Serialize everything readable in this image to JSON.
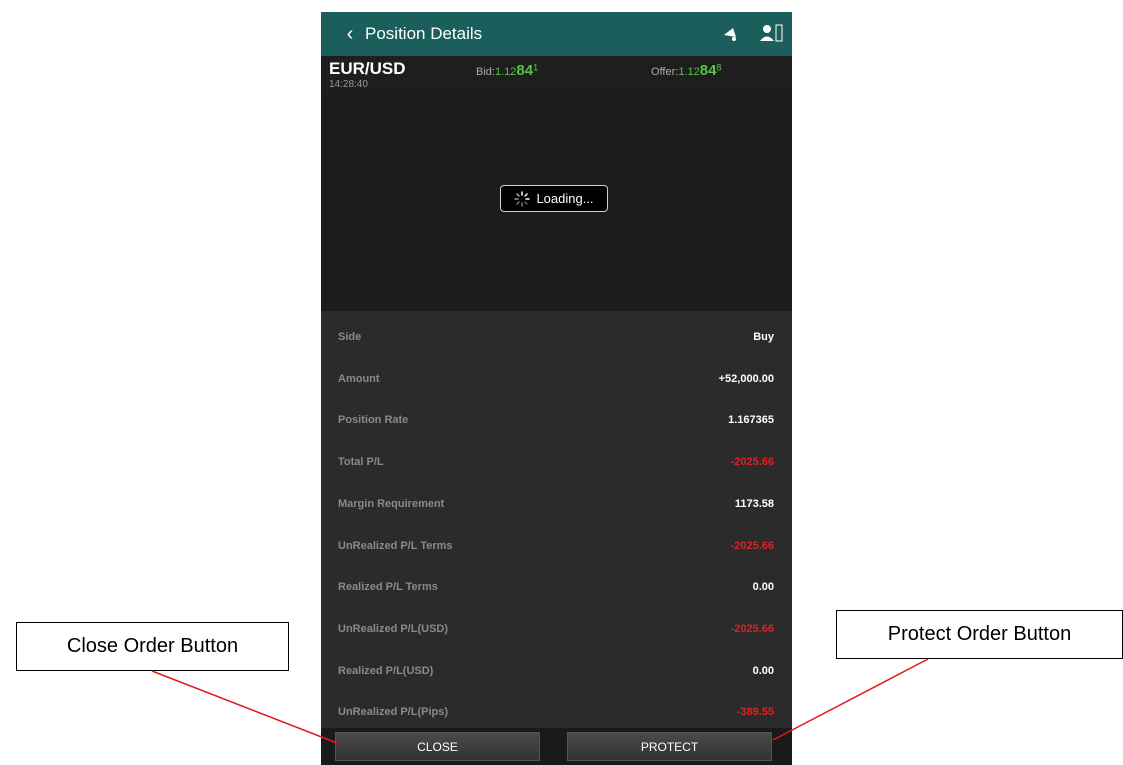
{
  "header": {
    "back": "‹",
    "title": "Position Details"
  },
  "quote": {
    "pair": "EUR/USD",
    "time": "14:28:40",
    "bid": {
      "label": "Bid:",
      "base": "1.12",
      "big": "84",
      "pip": "1"
    },
    "offer": {
      "label": "Offer:",
      "base": "1.12",
      "big": "84",
      "pip": "8"
    }
  },
  "chart": {
    "loading_text": "Loading..."
  },
  "details": [
    {
      "label": "Side",
      "value": "Buy",
      "negative": false
    },
    {
      "label": "Amount",
      "value": "+52,000.00",
      "negative": false
    },
    {
      "label": "Position Rate",
      "value": "1.167365",
      "negative": false
    },
    {
      "label": "Total P/L",
      "value": "-2025.66",
      "negative": true
    },
    {
      "label": "Margin Requirement",
      "value": "1173.58",
      "negative": false
    },
    {
      "label": "UnRealized P/L Terms",
      "value": "-2025.66",
      "negative": true
    },
    {
      "label": "Realized P/L Terms",
      "value": "0.00",
      "negative": false
    },
    {
      "label": "UnRealized P/L(USD)",
      "value": "-2025.66",
      "negative": true
    },
    {
      "label": "Realized P/L(USD)",
      "value": "0.00",
      "negative": false
    },
    {
      "label": "UnRealized P/L(Pips)",
      "value": "-389.55",
      "negative": true
    }
  ],
  "buttons": {
    "close": "CLOSE",
    "protect": "PROTECT"
  },
  "callouts": {
    "close": "Close Order Button",
    "protect": "Protect Order Button"
  },
  "colors": {
    "header": "#1a5f5b",
    "positive_price": "#55c547",
    "negative": "#e02020"
  }
}
